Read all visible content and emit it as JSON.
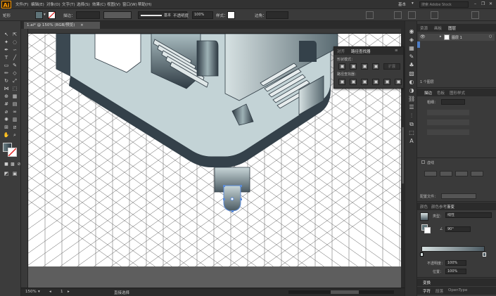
{
  "app": {
    "logo": "Ai"
  },
  "menu": [
    "文件(F)",
    "编辑(E)",
    "对象(O)",
    "文字(T)",
    "选择(S)",
    "效果(C)",
    "视图(V)",
    "窗口(W)",
    "帮助(H)"
  ],
  "menu_right": {
    "workspace": "基本",
    "search_placeholder": "搜索 Adobe Stock"
  },
  "control": {
    "selection": "矩形",
    "stroke_label": "描边：",
    "stroke_profile": "基本",
    "opacity_label": "不透明度",
    "opacity_value": "100%",
    "style_label": "样式：",
    "corner_label": "边角："
  },
  "document": {
    "tab_title": "1.ai* @ 150% (RGB/预览)",
    "close": "×"
  },
  "status": {
    "zoom": "150%",
    "artboard": "1",
    "tool_name": "直接选择"
  },
  "pathfinder": {
    "tabs": [
      "对齐",
      "路径查找器"
    ],
    "active_tab": "路径查找器",
    "shape_modes_label": "形状模式：",
    "expand_label": "扩展",
    "pathfinders_label": "路径查找器："
  },
  "layers_panel": {
    "tabs": [
      "资源",
      "画板",
      "图层"
    ],
    "active_tab": "图层",
    "layer_name": "图层 1",
    "footer": "1 个图层"
  },
  "stroke_panel": {
    "tabs": [
      "描边",
      "色板",
      "图形样式"
    ],
    "active_tab": "描边",
    "weight_label": "粗细：",
    "dashed_label": "虚线",
    "profile_label": "配置文件："
  },
  "gradient_panel": {
    "tabs": [
      "颜色",
      "颜色参考",
      "渐变"
    ],
    "active_tab": "渐变",
    "type_label": "类型：",
    "type_value": "线性",
    "angle_value": "90°",
    "opacity_label": "不透明度：",
    "opacity_value": "100%",
    "location_label": "位置：",
    "location_value": "100%"
  },
  "bottom_panels": {
    "transform_tab": "变换",
    "char_tabs": [
      "字符",
      "段落",
      "OpenType"
    ]
  },
  "colors": {
    "accent": "#5b8bd8",
    "object_dark": "#2f3b44",
    "object_light": "#c3d3d6",
    "gradient_start": "#d8e2e2",
    "gradient_end": "#4b5a62"
  }
}
